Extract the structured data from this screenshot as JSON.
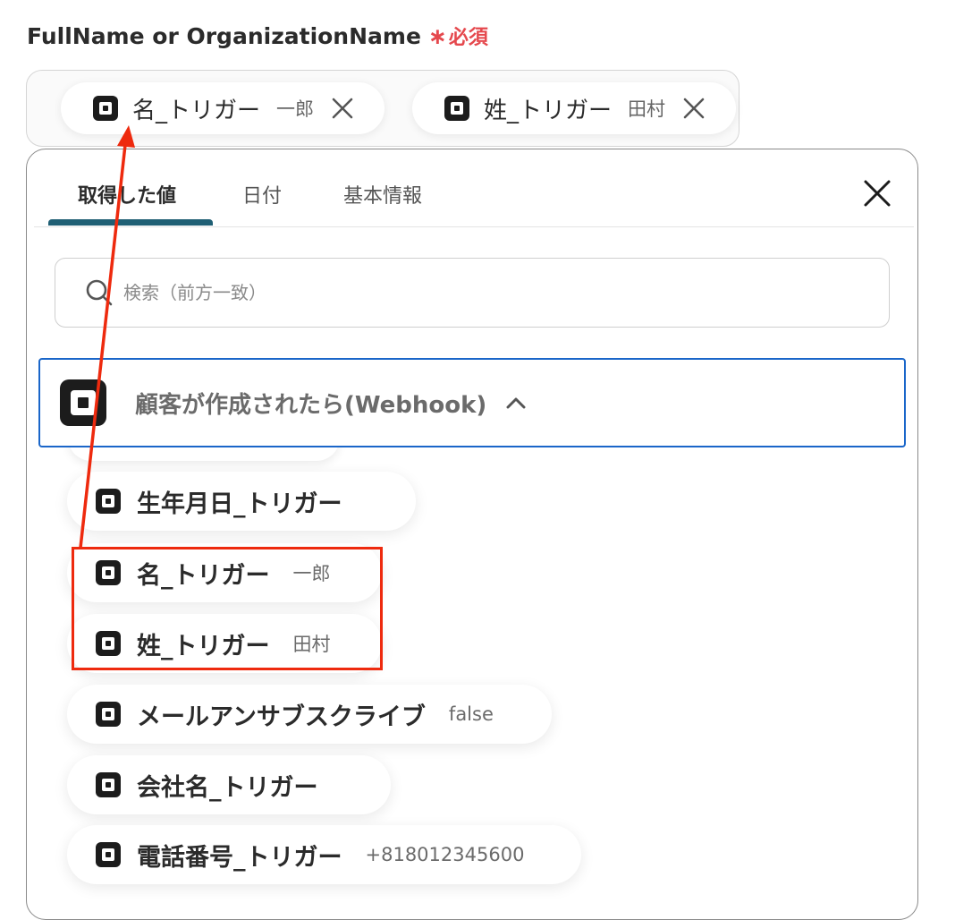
{
  "field": {
    "label": "FullName or OrganizationName",
    "asterisk": "∗",
    "required": "必須"
  },
  "selected_chips": [
    {
      "label": "名_トリガー",
      "value": "一郎"
    },
    {
      "label": "姓_トリガー",
      "value": "田村"
    }
  ],
  "panel": {
    "tabs": [
      "取得した値",
      "日付",
      "基本情報"
    ],
    "active_tab": "取得した値",
    "search_placeholder": "検索（前方一致）",
    "group_title": "顧客が作成されたら(Webhook)",
    "items": [
      {
        "label": "生年月日_トリガー",
        "value": ""
      },
      {
        "label": "名_トリガー",
        "value": "一郎"
      },
      {
        "label": "姓_トリガー",
        "value": "田村"
      },
      {
        "label": "メールアンサブスクライブ",
        "value": "false"
      },
      {
        "label": "会社名_トリガー",
        "value": ""
      },
      {
        "label": "電話番号_トリガー",
        "value": "+818012345600"
      }
    ]
  },
  "colors": {
    "required": "#e5484d",
    "tab_underline": "#1f5f74",
    "group_border": "#1a66c9",
    "annotation": "#ee2a0e"
  },
  "icons": {
    "item": "square-app-icon",
    "chip_remove": "close-icon",
    "panel_close": "close-icon",
    "search": "search-icon",
    "group_toggle": "chevron-up-icon"
  }
}
